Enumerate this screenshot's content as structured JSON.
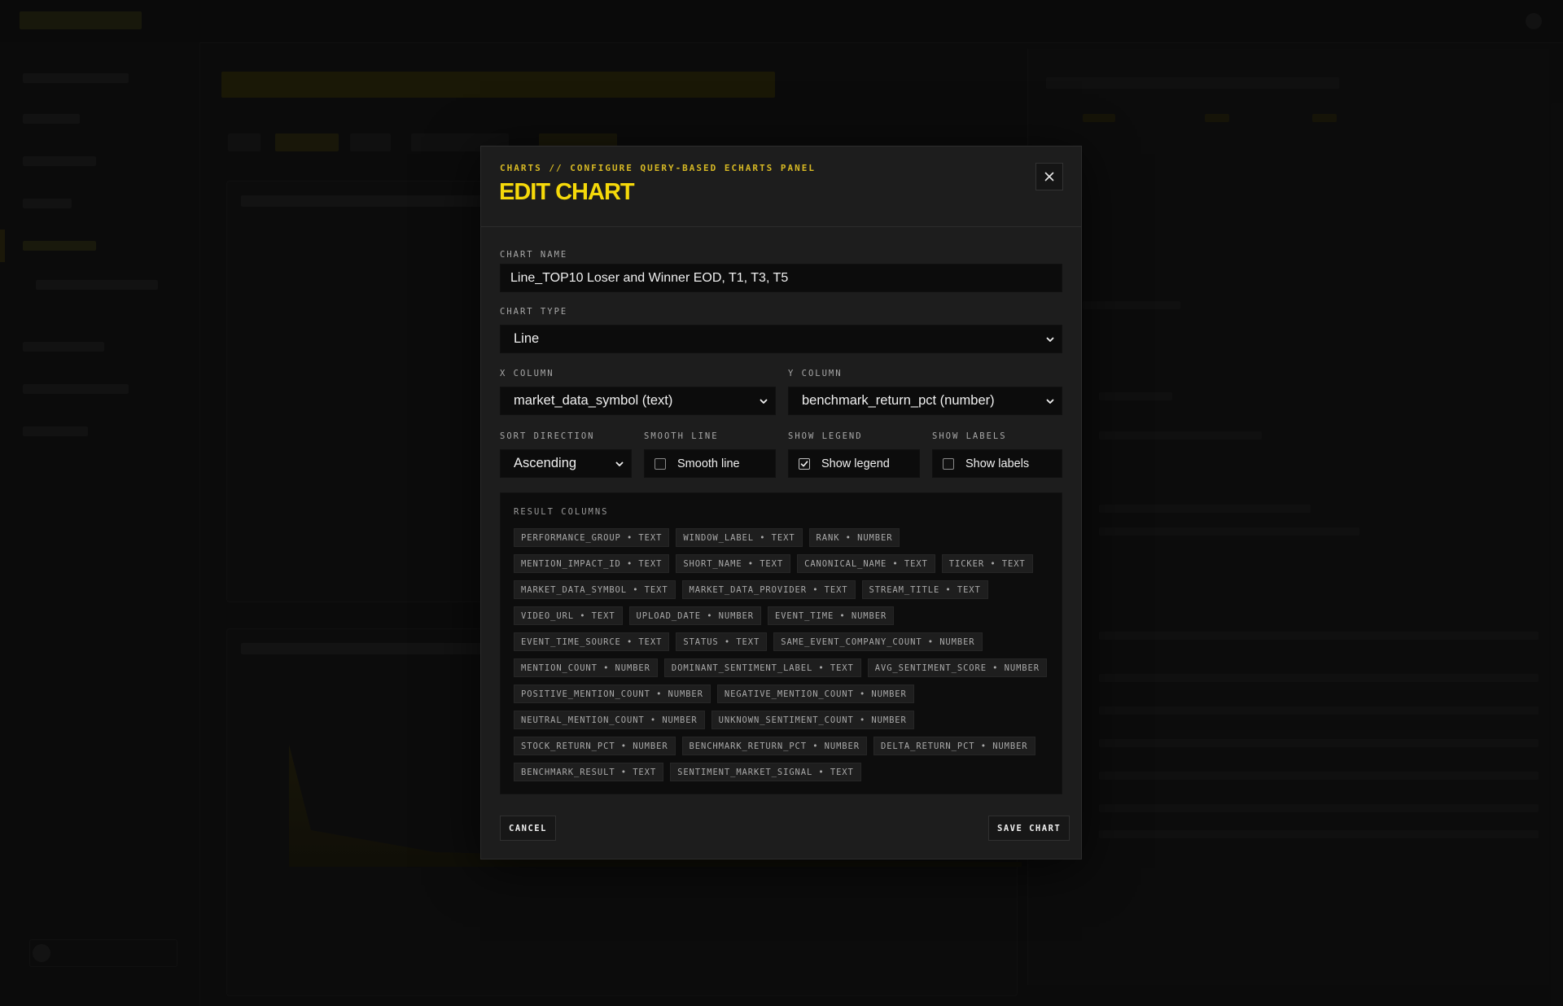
{
  "modal": {
    "eyebrow": "CHARTS // CONFIGURE QUERY-BASED ECHARTS PANEL",
    "title": "EDIT CHART",
    "close_icon": "close-icon"
  },
  "fields": {
    "chart_name": {
      "label": "CHART NAME",
      "value": "Line_TOP10 Loser and Winner EOD, T1, T3, T5"
    },
    "chart_type": {
      "label": "CHART TYPE",
      "value": "Line"
    },
    "x_column": {
      "label": "X COLUMN",
      "value": "market_data_symbol (text)"
    },
    "y_column": {
      "label": "Y COLUMN",
      "value": "benchmark_return_pct (number)"
    },
    "sort_direction": {
      "label": "SORT DIRECTION",
      "value": "Ascending"
    },
    "smooth_line": {
      "label": "SMOOTH LINE",
      "text": "Smooth line",
      "checked": false
    },
    "show_legend": {
      "label": "SHOW LEGEND",
      "text": "Show legend",
      "checked": true
    },
    "show_labels": {
      "label": "SHOW LABELS",
      "text": "Show labels",
      "checked": false
    }
  },
  "result_columns": {
    "title": "RESULT COLUMNS",
    "items": [
      "PERFORMANCE_GROUP • TEXT",
      "WINDOW_LABEL • TEXT",
      "RANK • NUMBER",
      "MENTION_IMPACT_ID • TEXT",
      "SHORT_NAME • TEXT",
      "CANONICAL_NAME • TEXT",
      "TICKER • TEXT",
      "MARKET_DATA_SYMBOL • TEXT",
      "MARKET_DATA_PROVIDER • TEXT",
      "STREAM_TITLE • TEXT",
      "VIDEO_URL • TEXT",
      "UPLOAD_DATE • NUMBER",
      "EVENT_TIME • NUMBER",
      "EVENT_TIME_SOURCE • TEXT",
      "STATUS • TEXT",
      "SAME_EVENT_COMPANY_COUNT • NUMBER",
      "MENTION_COUNT • NUMBER",
      "DOMINANT_SENTIMENT_LABEL • TEXT",
      "AVG_SENTIMENT_SCORE • NUMBER",
      "POSITIVE_MENTION_COUNT • NUMBER",
      "NEGATIVE_MENTION_COUNT • NUMBER",
      "NEUTRAL_MENTION_COUNT • NUMBER",
      "UNKNOWN_SENTIMENT_COUNT • NUMBER",
      "STOCK_RETURN_PCT • NUMBER",
      "BENCHMARK_RETURN_PCT • NUMBER",
      "DELTA_RETURN_PCT • NUMBER",
      "BENCHMARK_RESULT • TEXT",
      "SENTIMENT_MARKET_SIGNAL • TEXT"
    ]
  },
  "buttons": {
    "cancel": "CANCEL",
    "save": "SAVE CHART"
  },
  "colors": {
    "accent": "#f5d90a",
    "eyebrow": "#d7b924",
    "modal_bg": "#1d1d1d",
    "input_bg": "#0c0c0c"
  }
}
